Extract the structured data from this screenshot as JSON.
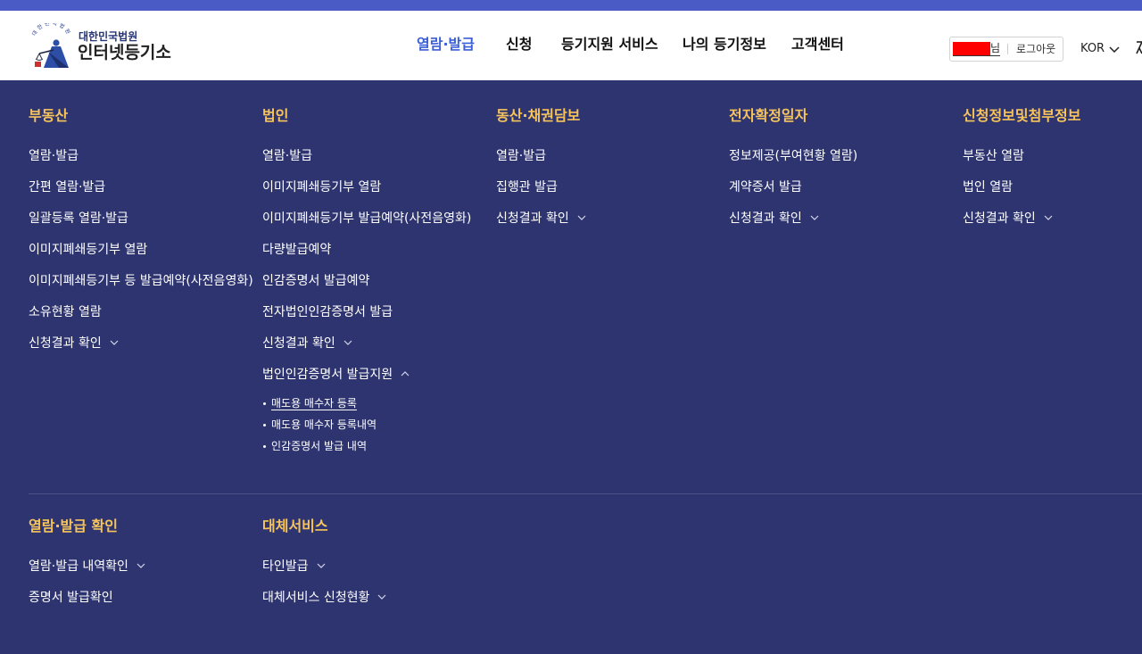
{
  "colors": {
    "top_strip": "#4b5bc6",
    "header_background": "#ffffff",
    "nav_text": "#111111",
    "nav_active": "#3b60d6",
    "menu_background": "#2e3470",
    "menu_heading": "#f6c45b",
    "menu_item": "#ffffff",
    "redaction": "#ff0000"
  },
  "header": {
    "logo": {
      "emblem_text": "대한민국법원",
      "subtitle": "대한민국법원",
      "title": "인터넷등기소"
    },
    "nav": [
      {
        "label": "열람·발급",
        "active": true
      },
      {
        "label": "신청",
        "active": false
      },
      {
        "label": "등기지원 서비스",
        "active": false
      },
      {
        "label": "나의 등기정보",
        "active": false
      },
      {
        "label": "고객센터",
        "active": false
      }
    ],
    "user": {
      "suffix": "님",
      "logout_label": "로그아웃"
    },
    "language": {
      "label": "KOR",
      "icon": "chevron-down-icon"
    },
    "edge_icon": "close-icon"
  },
  "menu": {
    "sections": [
      {
        "heading": "부동산",
        "items": [
          {
            "label": "열람·발급"
          },
          {
            "label": "간편 열람·발급"
          },
          {
            "label": "일괄등록 열람·발급"
          },
          {
            "label": "이미지폐쇄등기부 열람"
          },
          {
            "label": "이미지폐쇄등기부 등 발급예약(사전음영화)"
          },
          {
            "label": "소유현황 열람"
          },
          {
            "label": "신청결과 확인",
            "icon": "chevron-down-icon"
          }
        ]
      },
      {
        "heading": "법인",
        "items": [
          {
            "label": "열람·발급"
          },
          {
            "label": "이미지폐쇄등기부 열람"
          },
          {
            "label": "이미지폐쇄등기부 발급예약(사전음영화)"
          },
          {
            "label": "다량발급예약"
          },
          {
            "label": "인감증명서 발급예약"
          },
          {
            "label": "전자법인인감증명서 발급"
          },
          {
            "label": "신청결과 확인",
            "icon": "chevron-down-icon"
          },
          {
            "label": "법인인감증명서 발급지원",
            "icon": "chevron-up-icon",
            "expanded": true,
            "children": [
              {
                "label": "매도용 매수자 등록",
                "active": true
              },
              {
                "label": "매도용 매수자 등록내역"
              },
              {
                "label": "인감증명서 발급 내역"
              }
            ]
          }
        ]
      },
      {
        "heading": "동산·채권담보",
        "items": [
          {
            "label": "열람·발급"
          },
          {
            "label": "집행관 발급"
          },
          {
            "label": "신청결과 확인",
            "icon": "chevron-down-icon"
          }
        ]
      },
      {
        "heading": "전자확정일자",
        "items": [
          {
            "label": "정보제공(부여현황 열람)"
          },
          {
            "label": "계약증서 발급"
          },
          {
            "label": "신청결과 확인",
            "icon": "chevron-down-icon"
          }
        ]
      },
      {
        "heading": "신청정보및첨부정보",
        "items": [
          {
            "label": "부동산 열람"
          },
          {
            "label": "법인 열람"
          },
          {
            "label": "신청결과 확인",
            "icon": "chevron-down-icon"
          }
        ]
      }
    ],
    "bottom_sections": [
      {
        "heading": "열람·발급 확인",
        "items": [
          {
            "label": "열람·발급 내역확인",
            "icon": "chevron-down-icon"
          },
          {
            "label": "증명서 발급확인"
          }
        ]
      },
      {
        "heading": "대체서비스",
        "items": [
          {
            "label": "타인발급",
            "icon": "chevron-down-icon"
          },
          {
            "label": "대체서비스 신청현황",
            "icon": "chevron-down-icon"
          }
        ]
      }
    ]
  }
}
